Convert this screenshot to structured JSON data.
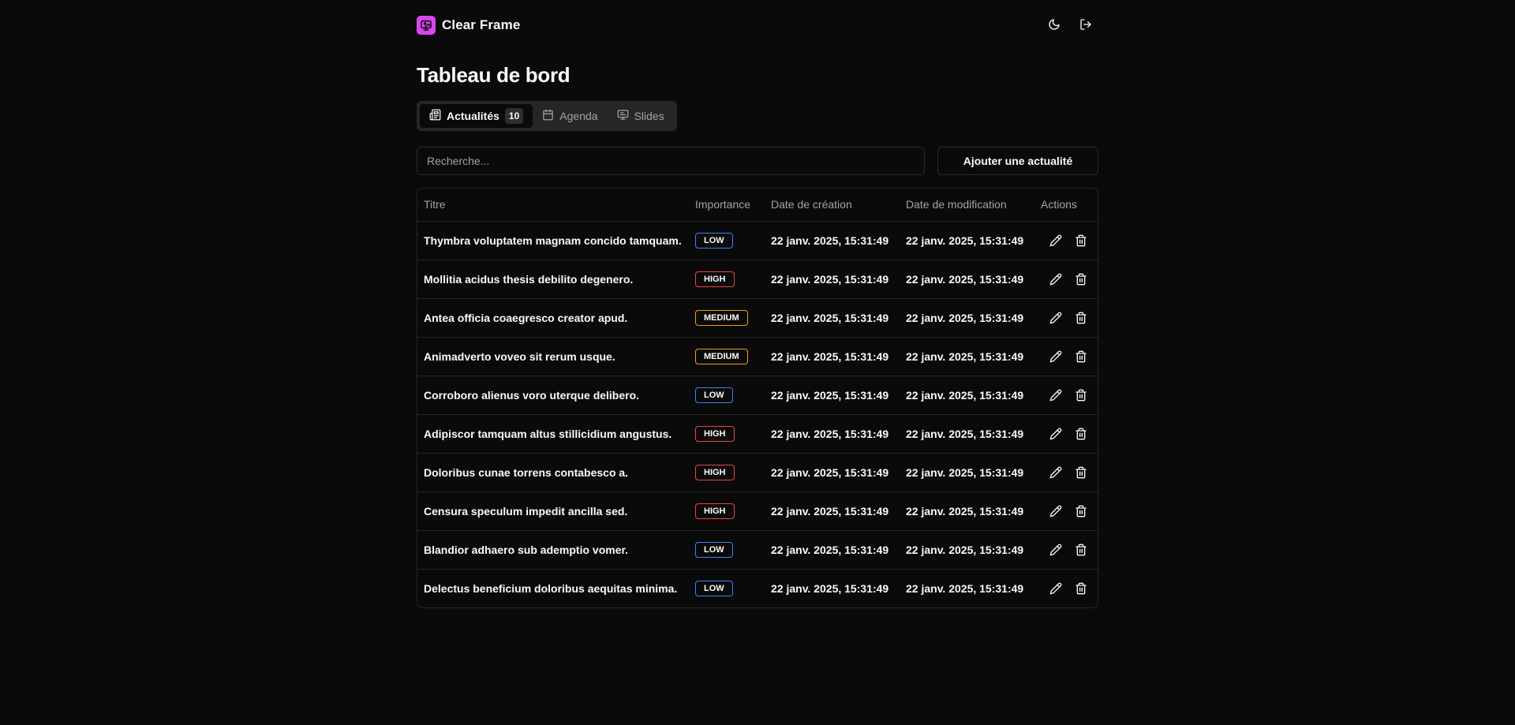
{
  "app": {
    "name": "Clear Frame",
    "brand_color": "#d946ef"
  },
  "header": {
    "icons": [
      "moon-icon",
      "logout-icon"
    ]
  },
  "page": {
    "title": "Tableau de bord"
  },
  "tabs": [
    {
      "label": "Actualités",
      "count": "10",
      "icon": "news-icon",
      "active": true
    },
    {
      "label": "Agenda",
      "icon": "calendar-icon",
      "active": false
    },
    {
      "label": "Slides",
      "icon": "presentation-icon",
      "active": false
    }
  ],
  "search": {
    "placeholder": "Recherche..."
  },
  "add_button": {
    "label": "Ajouter une actualité"
  },
  "table": {
    "columns": [
      "Titre",
      "Importance",
      "Date de création",
      "Date de modification",
      "Actions"
    ],
    "badge_colors": {
      "LOW": "#3b82f6",
      "HIGH": "#ef4444",
      "MEDIUM": "#f59e0b"
    },
    "rows": [
      {
        "title": "Thymbra voluptatem magnam concido tamquam.",
        "importance": "LOW",
        "created": "22 janv. 2025, 15:31:49",
        "modified": "22 janv. 2025, 15:31:49"
      },
      {
        "title": "Mollitia acidus thesis debilito degenero.",
        "importance": "HIGH",
        "created": "22 janv. 2025, 15:31:49",
        "modified": "22 janv. 2025, 15:31:49"
      },
      {
        "title": "Antea officia coaegresco creator apud.",
        "importance": "MEDIUM",
        "created": "22 janv. 2025, 15:31:49",
        "modified": "22 janv. 2025, 15:31:49"
      },
      {
        "title": "Animadverto voveo sit rerum usque.",
        "importance": "MEDIUM",
        "created": "22 janv. 2025, 15:31:49",
        "modified": "22 janv. 2025, 15:31:49"
      },
      {
        "title": "Corroboro alienus voro uterque delibero.",
        "importance": "LOW",
        "created": "22 janv. 2025, 15:31:49",
        "modified": "22 janv. 2025, 15:31:49"
      },
      {
        "title": "Adipiscor tamquam altus stillicidium angustus.",
        "importance": "HIGH",
        "created": "22 janv. 2025, 15:31:49",
        "modified": "22 janv. 2025, 15:31:49"
      },
      {
        "title": "Doloribus cunae torrens contabesco a.",
        "importance": "HIGH",
        "created": "22 janv. 2025, 15:31:49",
        "modified": "22 janv. 2025, 15:31:49"
      },
      {
        "title": "Censura speculum impedit ancilla sed.",
        "importance": "HIGH",
        "created": "22 janv. 2025, 15:31:49",
        "modified": "22 janv. 2025, 15:31:49"
      },
      {
        "title": "Blandior adhaero sub ademptio vomer.",
        "importance": "LOW",
        "created": "22 janv. 2025, 15:31:49",
        "modified": "22 janv. 2025, 15:31:49"
      },
      {
        "title": "Delectus beneficium doloribus aequitas minima.",
        "importance": "LOW",
        "created": "22 janv. 2025, 15:31:49",
        "modified": "22 janv. 2025, 15:31:49"
      }
    ],
    "row_actions": [
      "edit-icon",
      "trash-icon"
    ]
  }
}
